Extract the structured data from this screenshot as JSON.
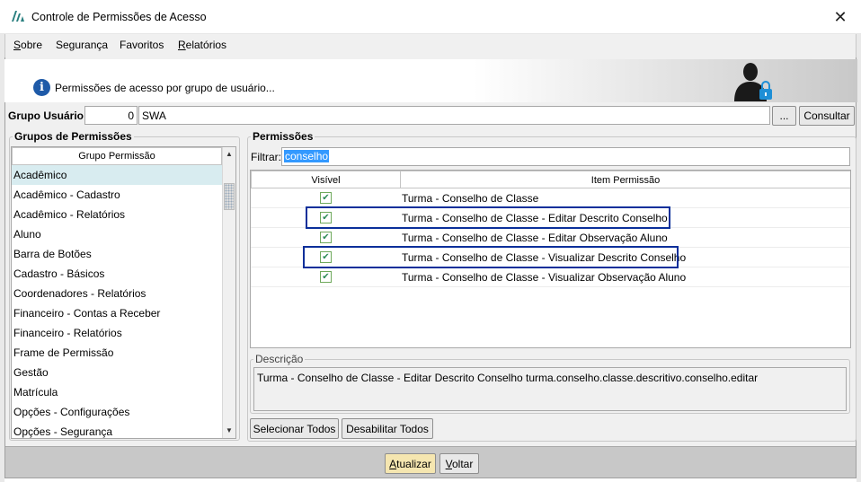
{
  "window": {
    "title": "Controle de Permissões de Acesso"
  },
  "menu": {
    "items": [
      "Sobre",
      "Segurança",
      "Favoritos",
      "Relatórios"
    ]
  },
  "banner": {
    "text": "Permissões de acesso por grupo de usuário..."
  },
  "user_group": {
    "label": "Grupo Usuário:",
    "id": "0",
    "name": "SWA",
    "browse_label": "...",
    "consult_label": "Consultar"
  },
  "groups_panel": {
    "title": "Grupos de Permissões",
    "column": "Grupo Permissão",
    "items": [
      "Acadêmico",
      "Acadêmico - Cadastro",
      "Acadêmico - Relatórios",
      "Aluno",
      "Barra de Botões",
      "Cadastro - Básicos",
      "Coordenadores - Relatórios",
      "Financeiro - Contas a Receber",
      "Financeiro - Relatórios",
      "Frame de Permissão",
      "Gestão",
      "Matrícula",
      "Opções - Configurações",
      "Opções - Segurança"
    ],
    "selected_index": 0
  },
  "permissions_panel": {
    "title": "Permissões",
    "filter_label": "Filtrar:",
    "filter_value": "conselho",
    "columns": [
      "Visível",
      "Item Permissão"
    ],
    "rows": [
      {
        "visible": true,
        "item": "Turma - Conselho de Classe",
        "highlighted": false
      },
      {
        "visible": true,
        "item": "Turma - Conselho de Classe - Editar Descrito Conselho",
        "highlighted": true
      },
      {
        "visible": true,
        "item": "Turma - Conselho de Classe - Editar Observação Aluno",
        "highlighted": false
      },
      {
        "visible": true,
        "item": "Turma - Conselho de Classe - Visualizar Descrito Conselho",
        "highlighted": true
      },
      {
        "visible": true,
        "item": "Turma - Conselho de Classe - Visualizar Observação Aluno",
        "highlighted": false
      }
    ],
    "description_title": "Descrição",
    "description": "Turma - Conselho de Classe - Editar Descrito Conselho turma.conselho.classe.descritivo.conselho.editar",
    "select_all_label": "Selecionar Todos",
    "disable_all_label": "Desabilitar Todos"
  },
  "footer": {
    "update_label": "Atualizar",
    "back_label": "Voltar"
  },
  "colors": {
    "highlight_border": "#0a2f9a",
    "selected_row": "#d8ecf0",
    "update_button": "#f5e6b0"
  }
}
